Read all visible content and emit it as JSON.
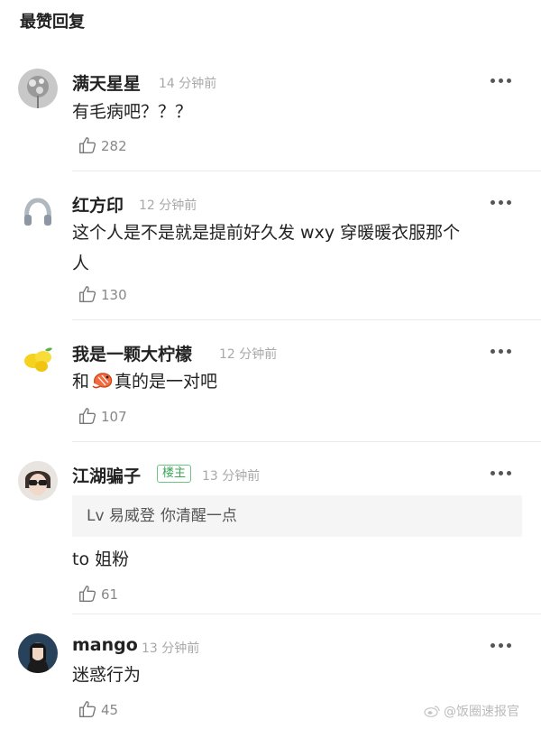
{
  "section": {
    "title": "最赞回复"
  },
  "comments": [
    {
      "user": "满天星星",
      "time": "14 分钟前",
      "text": "有毛病吧？？？",
      "likes": "282"
    },
    {
      "user": "红方印",
      "time": "12 分钟前",
      "text_line1": "这个人是不是就是提前好久发 wxy 穿暖暖衣服那个",
      "text_line2": "人",
      "likes": "130"
    },
    {
      "user": "我是一颗大柠檬",
      "time": "12 分钟前",
      "text_before": "和",
      "text_after": "真的是一对吧",
      "emoji": "shrimp-emoji",
      "likes": "107"
    },
    {
      "user": "江湖骗子",
      "badge": "楼主",
      "time": "13 分钟前",
      "quote_name": "Lv 易威登",
      "quote_text": "你清醒一点",
      "text": "to 姐粉",
      "likes": "61"
    },
    {
      "user": "mango",
      "time": "13 分钟前",
      "text": "迷惑行为",
      "likes": "45"
    }
  ],
  "watermark": {
    "text": "@饭圈速报官"
  },
  "icons": {
    "like": "thumbs-up-icon",
    "more": "more-dots-icon"
  },
  "colors": {
    "badge_green": "#3aa757",
    "muted": "#a8a8a8",
    "quote_bg": "#f5f5f5"
  }
}
